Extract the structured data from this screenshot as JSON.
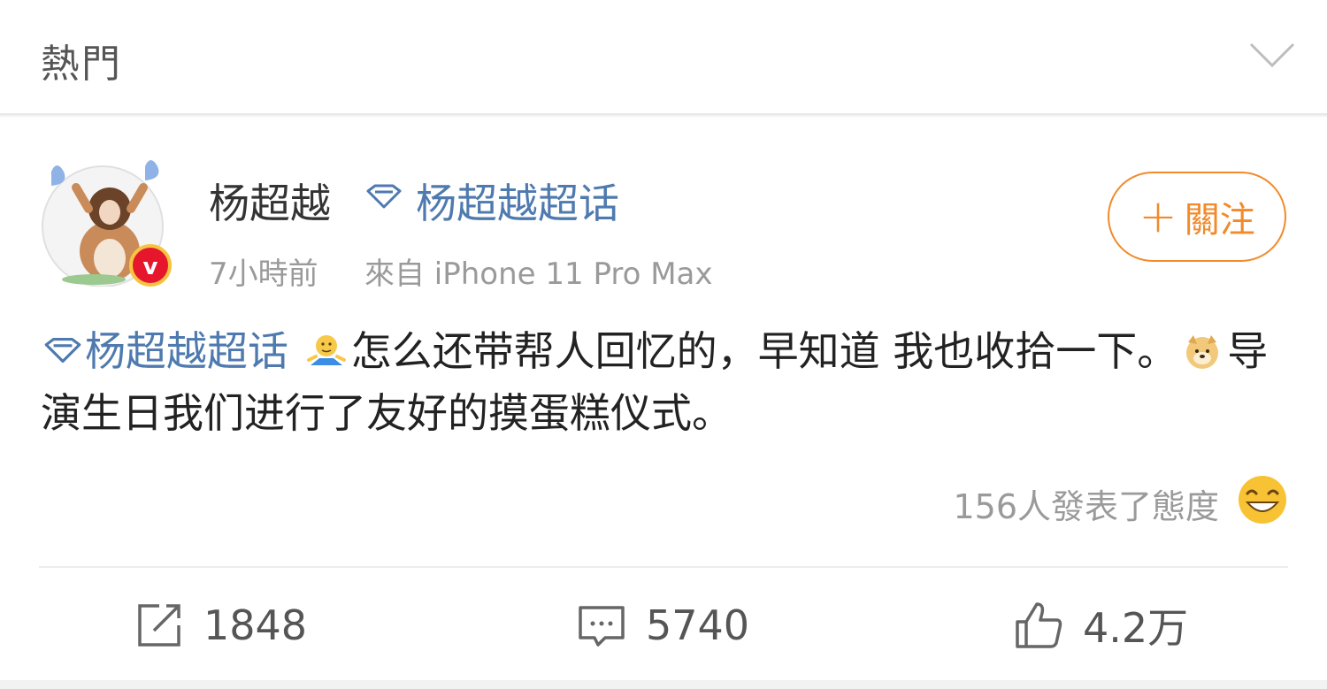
{
  "header": {
    "title": "熱門"
  },
  "post": {
    "username": "杨超越",
    "topic": "杨超越超话",
    "time": "7小時前",
    "source": "來自 iPhone 11 Pro Max",
    "follow_label": "關注",
    "follow_plus": "+",
    "text": {
      "hashtag": "杨超越超话",
      "part1": "怎么还带帮人回忆的，早知道 我也收拾一下。",
      "part2": "导演生日我们进行了友好的摸蛋糕仪式。"
    },
    "reactions": "156人發表了態度"
  },
  "actions": {
    "repost_count": "1848",
    "comment_count": "5740",
    "like_count": "4.2万"
  },
  "colors": {
    "link": "#4e7aaf",
    "accent": "#f28a2a",
    "verified": "#e6162d"
  }
}
